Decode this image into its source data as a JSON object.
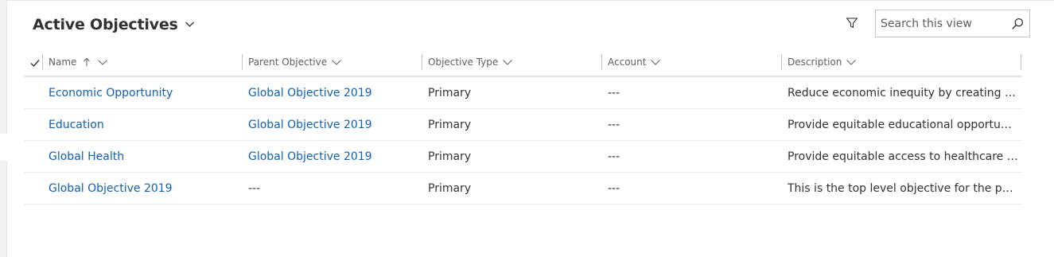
{
  "view": {
    "title": "Active Objectives"
  },
  "toolbar": {
    "filter_icon": "filter-icon",
    "search_placeholder": "Search this view",
    "search_icon": "search-icon"
  },
  "grid": {
    "columns": {
      "name": "Name",
      "parent": "Parent Objective",
      "type": "Objective Type",
      "account": "Account",
      "description": "Description"
    },
    "sort": {
      "column": "Name",
      "direction": "ascending"
    },
    "rows": [
      {
        "name": "Economic Opportunity",
        "parent": "Global Objective 2019",
        "type": "Primary",
        "account": "---",
        "description": "Reduce economic inequity by creating a …"
      },
      {
        "name": "Education",
        "parent": "Global Objective 2019",
        "type": "Primary",
        "account": "---",
        "description": "Provide equitable educational opportunit…"
      },
      {
        "name": "Global Health",
        "parent": "Global Objective 2019",
        "type": "Primary",
        "account": "---",
        "description": "Provide equitable access to healthcare fo…"
      },
      {
        "name": "Global Objective 2019",
        "parent": "---",
        "type": "Primary",
        "account": "---",
        "description": "This is the top level objective for the peri…"
      }
    ]
  },
  "colors": {
    "link": "#1160b7",
    "text": "#323130",
    "header_text": "#605e5c"
  }
}
